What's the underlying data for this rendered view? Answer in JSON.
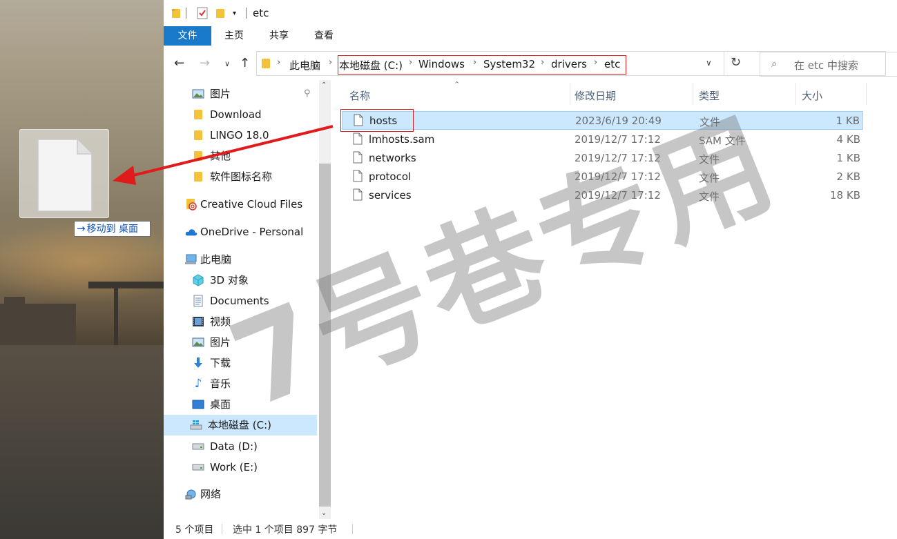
{
  "window": {
    "title": "etc"
  },
  "ribbon": {
    "tabs": [
      "文件",
      "主页",
      "共享",
      "查看"
    ]
  },
  "address": {
    "crumbs": [
      "此电脑",
      "本地磁盘 (C:)",
      "Windows",
      "System32",
      "drivers",
      "etc"
    ]
  },
  "search": {
    "placeholder": "在 etc 中搜索"
  },
  "nav": {
    "items": [
      {
        "label": "图片",
        "icon": "pictures-icon",
        "pinned": true
      },
      {
        "label": "Download",
        "icon": "folder-icon"
      },
      {
        "label": "LINGO 18.0",
        "icon": "folder-icon"
      },
      {
        "label": "其他",
        "icon": "folder-icon"
      },
      {
        "label": "软件图标名称",
        "icon": "folder-icon"
      },
      {
        "label": "Creative Cloud Files",
        "icon": "creative-cloud-icon"
      },
      {
        "label": "OneDrive - Personal",
        "icon": "onedrive-icon"
      },
      {
        "label": "此电脑",
        "icon": "computer-icon"
      },
      {
        "label": "3D 对象",
        "icon": "3d-objects-icon"
      },
      {
        "label": "Documents",
        "icon": "documents-icon"
      },
      {
        "label": "视频",
        "icon": "video-icon"
      },
      {
        "label": "图片",
        "icon": "pictures-icon"
      },
      {
        "label": "下载",
        "icon": "download-icon"
      },
      {
        "label": "音乐",
        "icon": "music-icon"
      },
      {
        "label": "桌面",
        "icon": "desktop-icon"
      },
      {
        "label": "本地磁盘 (C:)",
        "icon": "windows-drive-icon",
        "selected": true
      },
      {
        "label": "Data (D:)",
        "icon": "drive-icon"
      },
      {
        "label": "Work (E:)",
        "icon": "drive-icon"
      },
      {
        "label": "网络",
        "icon": "network-icon"
      }
    ]
  },
  "columns": {
    "name": "名称",
    "date": "修改日期",
    "type": "类型",
    "size": "大小"
  },
  "files": [
    {
      "name": "hosts",
      "date": "2023/6/19 20:49",
      "type": "文件",
      "size": "1 KB",
      "selected": true
    },
    {
      "name": "lmhosts.sam",
      "date": "2019/12/7 17:12",
      "type": "SAM 文件",
      "size": "4 KB"
    },
    {
      "name": "networks",
      "date": "2019/12/7 17:12",
      "type": "文件",
      "size": "1 KB"
    },
    {
      "name": "protocol",
      "date": "2019/12/7 17:12",
      "type": "文件",
      "size": "2 KB"
    },
    {
      "name": "services",
      "date": "2019/12/7 17:12",
      "type": "文件",
      "size": "18 KB"
    }
  ],
  "status": {
    "count": "5 个项目",
    "selection": "选中 1 个项目  897 字节"
  },
  "drag": {
    "tooltip_action": "移动到",
    "tooltip_target": "桌面"
  },
  "watermark": "7号巷专用",
  "colors": {
    "accent": "#1979ca",
    "selection": "#cce8ff",
    "annotation": "#e01b1b"
  }
}
